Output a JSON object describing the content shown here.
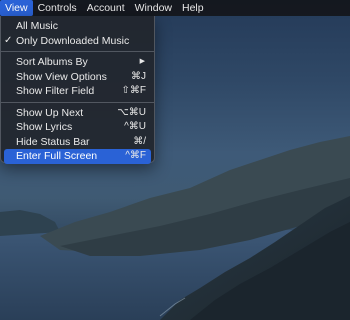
{
  "menubar": {
    "items": [
      "View",
      "Controls",
      "Account",
      "Window",
      "Help"
    ]
  },
  "view_menu": {
    "group1": [
      {
        "label": "All Music",
        "checked": false
      },
      {
        "label": "Only Downloaded Music",
        "checked": true,
        "check_glyph": "✓"
      }
    ],
    "group2": [
      {
        "label": "Sort Albums By",
        "submenu_glyph": "▶"
      },
      {
        "label": "Show View Options",
        "shortcut": "⌘J"
      },
      {
        "label": "Show Filter Field",
        "shortcut": "⇧⌘F"
      }
    ],
    "group3": [
      {
        "label": "Show Up Next",
        "shortcut": "⌥⌘U"
      },
      {
        "label": "Show Lyrics",
        "shortcut": "^⌘U"
      },
      {
        "label": "Hide Status Bar",
        "shortcut": "⌘/"
      },
      {
        "label": "Enter Full Screen",
        "shortcut": "^⌘F",
        "highlighted": true
      }
    ]
  },
  "colors": {
    "menubar_bg": "#16181c",
    "highlight": "#2a62d6",
    "menu_bg": "#22262e"
  }
}
